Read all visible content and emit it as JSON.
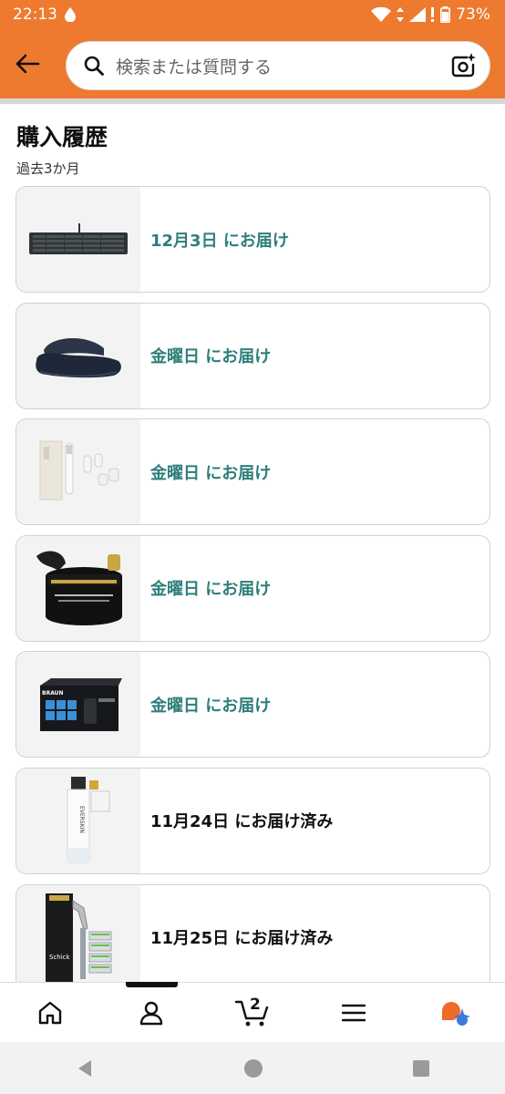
{
  "status": {
    "time": "22:13",
    "battery": "73%"
  },
  "header": {
    "search_placeholder": "検索または質問する"
  },
  "page": {
    "title": "購入履歴",
    "subtitle": "過去3か月"
  },
  "orders": [
    {
      "status_text": "12月3日  にお届け",
      "state": "pending",
      "product_icon": "keyboard-image"
    },
    {
      "status_text": "金曜日  にお届け",
      "state": "pending",
      "product_icon": "slipper-image"
    },
    {
      "status_text": "金曜日  にお届け",
      "state": "pending",
      "product_icon": "trimmer-image"
    },
    {
      "status_text": "金曜日  にお届け",
      "state": "pending",
      "product_icon": "face-wash-jar-image"
    },
    {
      "status_text": "金曜日  にお届け",
      "state": "pending",
      "product_icon": "braun-refill-box-image"
    },
    {
      "status_text": "11月24日  にお届け済み",
      "state": "delivered",
      "product_icon": "skincare-bottle-image"
    },
    {
      "status_text": "11月25日  にお届け済み",
      "state": "delivered",
      "product_icon": "schick-razor-pack-image"
    }
  ],
  "product_labels": {
    "braun": "BRAUN",
    "everskin": "EVERSKIN",
    "schick": "Schick"
  },
  "nav": {
    "cart_count": "2",
    "active_index": 1
  },
  "colors": {
    "brand_orange": "#ee7a2f",
    "pending_teal": "#2e7e7b",
    "delivered_text": "#0f1111",
    "ai_orange": "#f06a2a",
    "ai_blue": "#3d7be0"
  }
}
